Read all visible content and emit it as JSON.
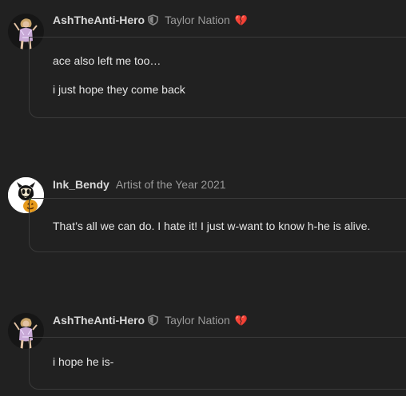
{
  "posts": [
    {
      "username": "AshTheAnti-Hero",
      "usertitle": "Taylor Nation",
      "badge_icon": "broken-heart-icon",
      "avatar_icon": "taylor-swift-avatar",
      "lines": [
        "ace also left me too…",
        "i just hope they come back"
      ]
    },
    {
      "username": "Ink_Bendy",
      "usertitle": "Artist of the Year 2021",
      "avatar_icon": "bendy-avatar",
      "lines": [
        "That’s all we can do. I hate it! I just w-want to know h-he is alive."
      ]
    },
    {
      "username": "AshTheAnti-Hero",
      "usertitle": "Taylor Nation",
      "badge_icon": "broken-heart-icon",
      "avatar_icon": "taylor-swift-avatar",
      "lines": [
        "i hope he is-"
      ]
    }
  ],
  "colors": {
    "background": "#212121",
    "username": "#d8d8d8",
    "usertitle": "#9a9a9a",
    "text": "#e6e6e6",
    "border": "#3a3a3a",
    "broken_heart": "#d9303a"
  }
}
